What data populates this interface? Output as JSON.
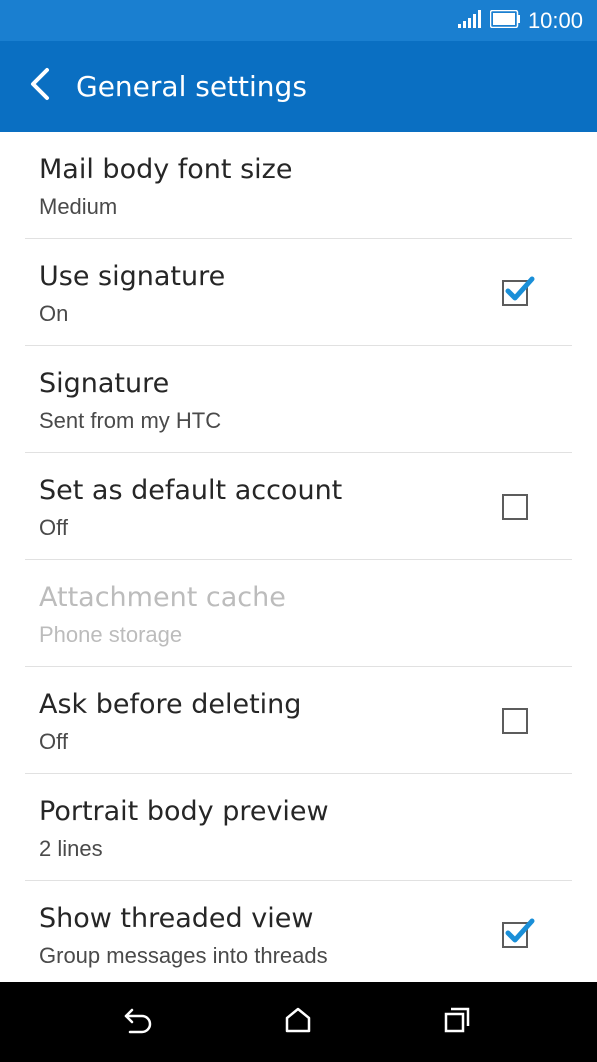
{
  "status_bar": {
    "time": "10:00",
    "icons": [
      "signal-icon",
      "battery-icon"
    ]
  },
  "app_bar": {
    "title": "General settings",
    "back_icon": "back-chevron-icon",
    "color": "#0a6fc2"
  },
  "settings": [
    {
      "title": "Mail body font size",
      "value": "Medium",
      "has_checkbox": false,
      "enabled": true
    },
    {
      "title": "Use signature",
      "value": "On",
      "has_checkbox": true,
      "checked": true,
      "enabled": true
    },
    {
      "title": "Signature",
      "value": "Sent from my HTC",
      "has_checkbox": false,
      "enabled": true
    },
    {
      "title": "Set as default account",
      "value": "Off",
      "has_checkbox": true,
      "checked": false,
      "enabled": true
    },
    {
      "title": "Attachment cache",
      "value": "Phone storage",
      "has_checkbox": false,
      "enabled": false
    },
    {
      "title": "Ask before deleting",
      "value": "Off",
      "has_checkbox": true,
      "checked": false,
      "enabled": true
    },
    {
      "title": "Portrait body preview",
      "value": "2 lines",
      "has_checkbox": false,
      "enabled": true
    },
    {
      "title": "Show threaded view",
      "value": "Group messages into threads",
      "has_checkbox": true,
      "checked": true,
      "enabled": true
    }
  ],
  "nav_bar": {
    "icons": [
      "back-icon",
      "home-icon",
      "recent-apps-icon"
    ]
  },
  "colors": {
    "status_bar": "#1a7fd0",
    "app_bar": "#0a6fc2",
    "check_accent": "#1a8fd8"
  }
}
